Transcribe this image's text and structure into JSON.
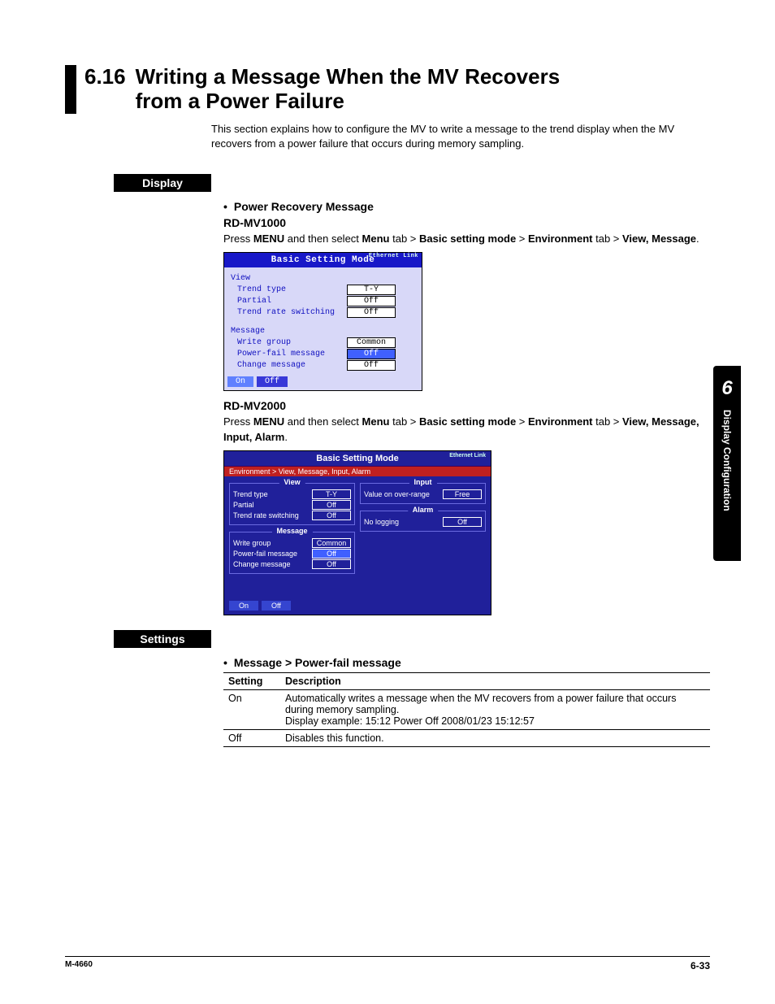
{
  "section": {
    "number": "6.16",
    "title_l1": "Writing a Message When the MV Recovers",
    "title_l2": "from a Power Failure"
  },
  "intro": "This section explains how to configure the MV to write a message to the trend display when the MV recovers from a power failure that occurs during memory sampling.",
  "headings": {
    "display": "Display",
    "settings": "Settings"
  },
  "display": {
    "bullet": "Power Recovery Message",
    "mv1000": {
      "model": "RD-MV1000",
      "press": "Press ",
      "menu": "MENU",
      "sel": " and then select ",
      "m1": "Menu",
      "tab": " tab > ",
      "m2": "Basic setting mode",
      "m3": "Environment",
      "tab2": " tab > ",
      "m4": "View, Message",
      "dot": "."
    },
    "mv2000": {
      "model": "RD-MV2000",
      "press": "Press ",
      "menu": "MENU",
      "sel": " and then select ",
      "m1": "Menu",
      "tab": " tab > ",
      "m2": "Basic setting mode",
      "m3": "Environment",
      "tab2": " tab > ",
      "m4": "View, Message, Input, Alarm",
      "dot": "."
    }
  },
  "screen1": {
    "title": "Basic Setting Mode",
    "eth": "Ethernet\nLink",
    "g1": "View",
    "r1l": "Trend type",
    "r1v": "T-Y",
    "r2l": "Partial",
    "r2v": "Off",
    "r3l": "Trend rate switching",
    "r3v": "Off",
    "g2": "Message",
    "r4l": "Write group",
    "r4v": "Common",
    "r5l": "Power-fail message",
    "r5v": "Off",
    "r6l": "Change message",
    "r6v": "Off",
    "btn_on": "On",
    "btn_off": "Off"
  },
  "screen2": {
    "title": "Basic Setting Mode",
    "eth": "Ethernet\nLink",
    "crumb": "Environment > View, Message, Input, Alarm",
    "view": {
      "legend": "View",
      "r1l": "Trend type",
      "r1v": "T-Y",
      "r2l": "Partial",
      "r2v": "Off",
      "r3l": "Trend rate switching",
      "r3v": "Off"
    },
    "message": {
      "legend": "Message",
      "r1l": "Write group",
      "r1v": "Common",
      "r2l": "Power-fail message",
      "r2v": "Off",
      "r3l": "Change message",
      "r3v": "Off"
    },
    "input": {
      "legend": "Input",
      "r1l": "Value on over-range",
      "r1v": "Free"
    },
    "alarm": {
      "legend": "Alarm",
      "r1l": "No logging",
      "r1v": "Off"
    },
    "btn_on": "On",
    "btn_off": "Off"
  },
  "settings": {
    "bullet": "Message > Power-fail message",
    "th1": "Setting",
    "th2": "Description",
    "rows": [
      {
        "s": "On",
        "d1": "Automatically writes a message when the MV recovers from a power failure that occurs during memory sampling.",
        "d2": "Display example: 15:12 Power Off 2008/01/23 15:12:57"
      },
      {
        "s": "Off",
        "d1": "Disables this function.",
        "d2": ""
      }
    ]
  },
  "sidetab": {
    "num": "6",
    "text": "Display Configuration"
  },
  "footer": {
    "left": "M-4660",
    "right": "6-33"
  }
}
